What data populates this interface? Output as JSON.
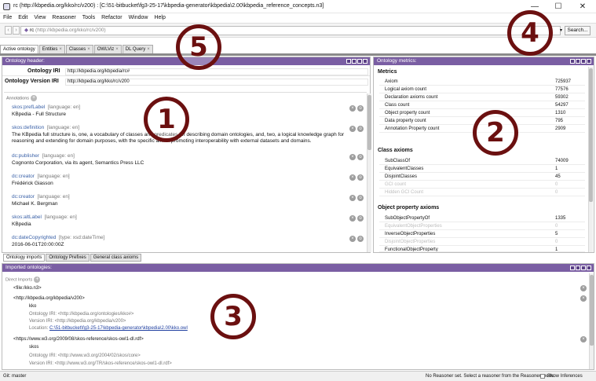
{
  "window": {
    "title": "rc (http://kbpedia.org/kko/rc/v200) : [C:\\51-bitbucket\\fg3-25-17\\kbpedia-generator\\kbpedia\\2.00\\kbpedia_reference_concepts.n3]",
    "minimize": "—",
    "maximize": "☐",
    "close": "✕"
  },
  "menu": [
    "File",
    "Edit",
    "View",
    "Reasoner",
    "Tools",
    "Refactor",
    "Window",
    "Help"
  ],
  "address": {
    "back": "‹",
    "forward": "›",
    "prefix": "rc",
    "iri": "(http://kbpedia.org/kko/rc/v200)",
    "dropdown": "▾",
    "search_label": "Search..."
  },
  "tabs": [
    {
      "label": "Active ontology",
      "close": "×"
    },
    {
      "label": "Entities",
      "close": "×"
    },
    {
      "label": "Classes",
      "close": "×"
    },
    {
      "label": "OWLViz",
      "close": "×"
    },
    {
      "label": "DL Query",
      "close": "×"
    }
  ],
  "header_panel": {
    "title": "Ontology header:",
    "iri_label": "Ontology IRI",
    "iri_value": "http://kbpedia.org/kbpedia/rc#",
    "version_label": "Ontology Version IRI",
    "version_value": "http://kbpedia.org/kko/rc/v200",
    "annotations_label": "Annotations",
    "add": "+",
    "annotations": [
      {
        "key": "skos:prefLabel",
        "meta": "[language: en]",
        "value": "KBpedia - Full Structure"
      },
      {
        "key": "skos:definition",
        "meta": "[language: en]",
        "value": "The KBpedia full structure is, one, a vocabulary of classes and predicates for describing domain ontologies, and, two, a logical knowledge graph for reasoning and extending for domain purposes, with the specific aim of promoting interoperability with external datasets and domains."
      },
      {
        "key": "dc:publisher",
        "meta": "[language: en]",
        "value": "Cognonto Corporation, via its agent, Semantics Press LLC"
      },
      {
        "key": "dc:creator",
        "meta": "[language: en]",
        "value": "Frédérick Giasson"
      },
      {
        "key": "dc:creator",
        "meta": "[language: en]",
        "value": "Michael K. Bergman"
      },
      {
        "key": "skos:altLabel",
        "meta": "[language: en]",
        "value": "KBpedia"
      },
      {
        "key": "dc:dateCopyrighted",
        "meta": "[type: xsd:dateTime]",
        "value": "2016-06-01T20:00:00Z"
      }
    ],
    "row_x": "×",
    "row_o": "o"
  },
  "bottom_tabs": [
    "Ontology imports",
    "Ontology Prefixes",
    "General class axioms"
  ],
  "metrics": {
    "title": "Ontology metrics:",
    "sections": [
      {
        "heading": "Metrics",
        "rows": [
          {
            "label": "Axiom",
            "value": "725937"
          },
          {
            "label": "Logical axiom count",
            "value": "77576"
          },
          {
            "label": "Declaration axioms count",
            "value": "59302"
          },
          {
            "label": "Class count",
            "value": "54297"
          },
          {
            "label": "Object property count",
            "value": "1310"
          },
          {
            "label": "Data property count",
            "value": "795"
          },
          {
            "label": "Annotation Property count",
            "value": "2909"
          }
        ]
      },
      {
        "heading": "Class axioms",
        "rows": [
          {
            "label": "SubClassOf",
            "value": "74009"
          },
          {
            "label": "EquivalentClasses",
            "value": "1"
          },
          {
            "label": "DisjointClasses",
            "value": "45"
          },
          {
            "label": "GCI count",
            "value": "0",
            "disabled": true
          },
          {
            "label": "Hidden GCI Count",
            "value": "0",
            "disabled": true
          }
        ]
      },
      {
        "heading": "Object property axioms",
        "rows": [
          {
            "label": "SubObjectPropertyOf",
            "value": "1335"
          },
          {
            "label": "EquivalentObjectProperties",
            "value": "0",
            "disabled": true
          },
          {
            "label": "InverseObjectProperties",
            "value": "5"
          },
          {
            "label": "DisjointObjectProperties",
            "value": "0",
            "disabled": true
          },
          {
            "label": "FunctionalObjectProperty",
            "value": "1"
          }
        ]
      }
    ]
  },
  "imports": {
    "title": "Imported ontologies:",
    "direct_label": "Direct Imports",
    "add": "+",
    "file": "<file:/kko.n3>",
    "kko_iri": "<http://kbpedia.org/kbpedia/v200>",
    "kko_name": "kko",
    "kko_ont_iri": "Ontology IRI: <http://kbpedia.org/ontologies/kko#>",
    "kko_ver_iri": "Version IRI: <http://kbpedia.org/kbpedia/v200>",
    "kko_loc_label": "Location:",
    "kko_loc": "C:\\51-bitbucket\\fg3-25-17\\kbpedia-generator\\kbpedia\\2.00\\kko.owl",
    "skos_iri": "<https://www.w3.org/2009/08/skos-reference/skos-owl1-dl.rdf>",
    "skos_name": "skos",
    "skos_ont_iri": "Ontology IRI: <http://www.w3.org/2004/02/skos/core>",
    "skos_ver_iri": "Version IRI: <http://www.w3.org/TR/skos-reference/skos-owl1-dl.rdf>",
    "remove": "×"
  },
  "status": {
    "git": "Git: master",
    "reasoner": "No Reasoner set. Select a reasoner from the Reasoner menu",
    "show_inferences": "Show Inferences"
  },
  "callouts": [
    "1",
    "2",
    "3",
    "4",
    "5"
  ]
}
